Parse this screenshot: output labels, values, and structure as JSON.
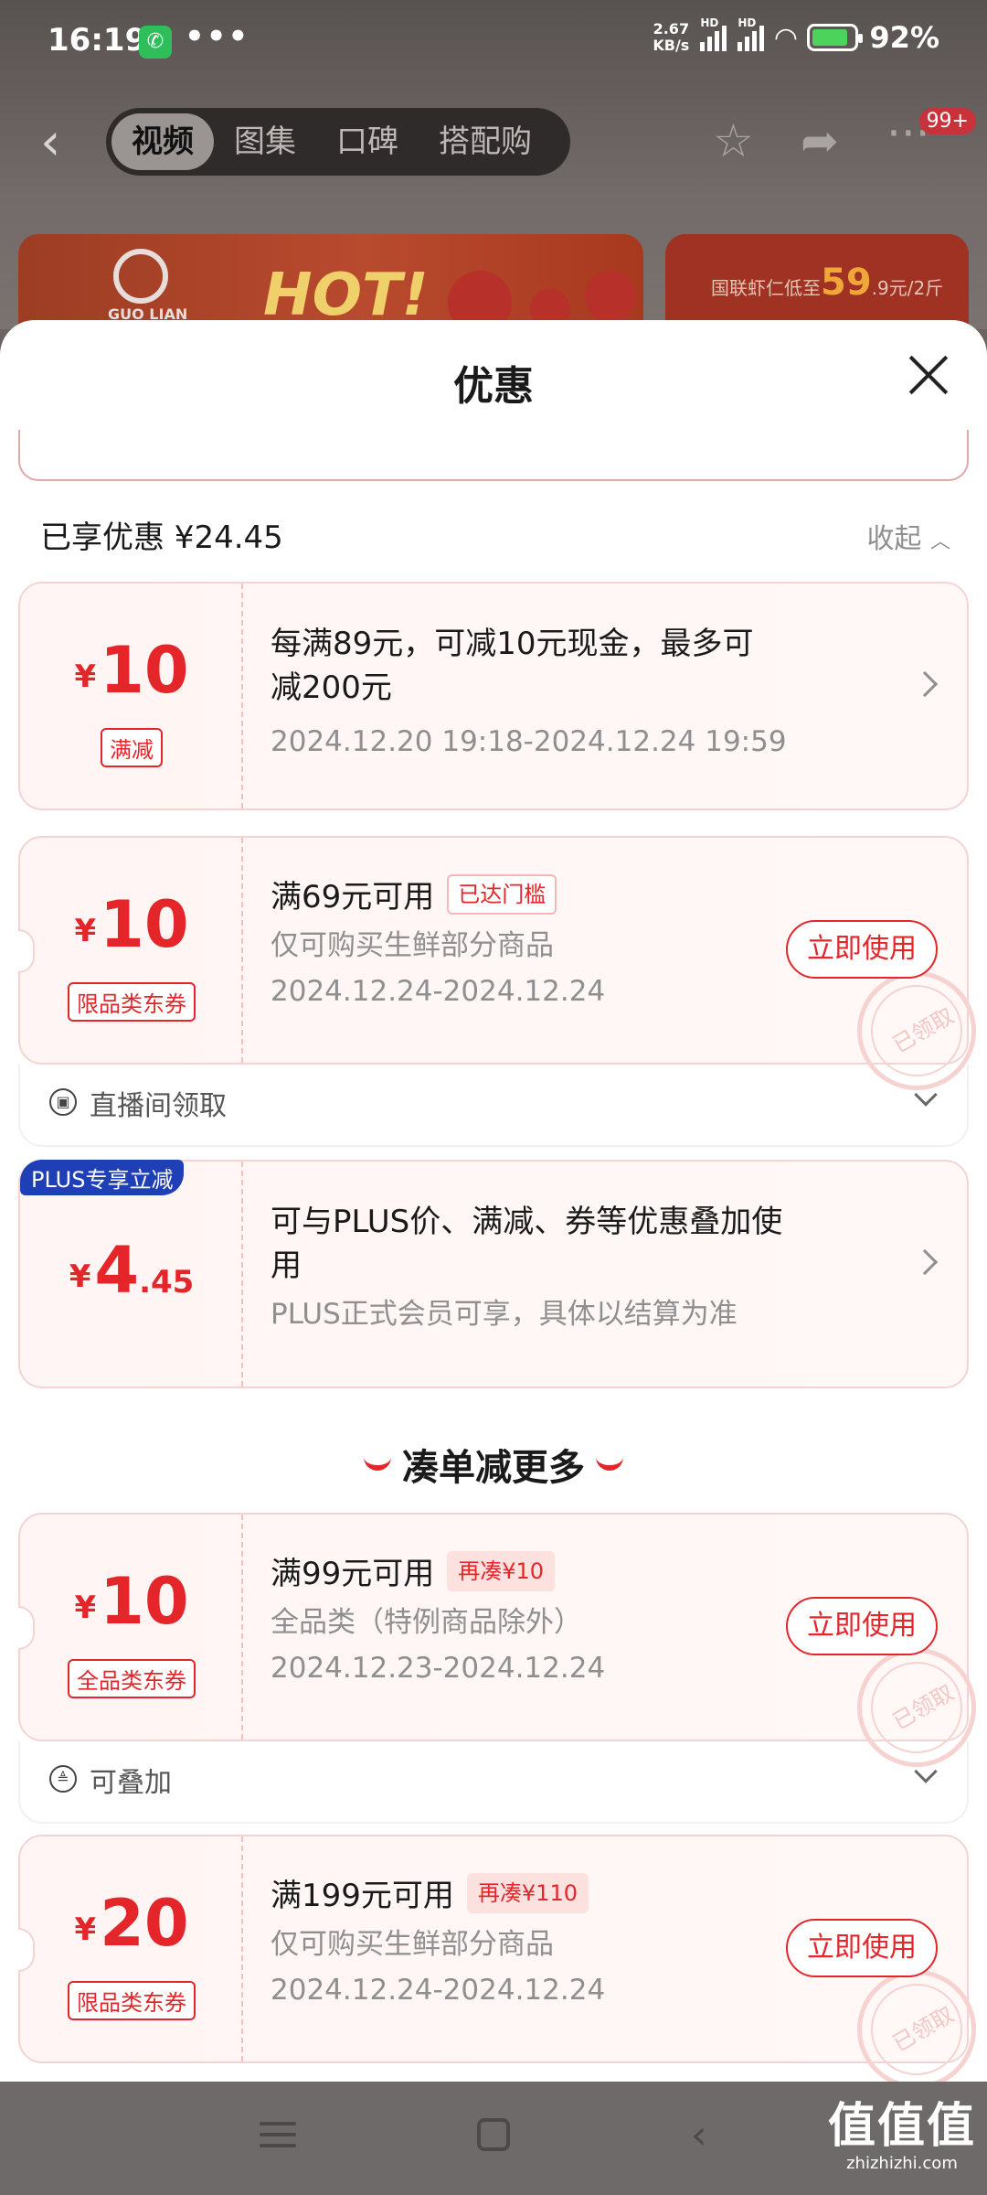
{
  "status_bar": {
    "time": "16:19",
    "dots": "•••",
    "net_speed_value": "2.67",
    "net_speed_unit": "KB/s",
    "hd1": "HD",
    "hd2": "HD",
    "battery": "92%"
  },
  "nav": {
    "tabs": [
      "视频",
      "图集",
      "口碑",
      "搭配购"
    ],
    "badge": "99+"
  },
  "banners": {
    "left_logo": "GUO LIAN",
    "left_hot": "HOT!",
    "right_prefix": "国联虾仁低至",
    "right_price": "59",
    "right_suffix": ".9元/2斤"
  },
  "sheet": {
    "title": "优惠",
    "enjoyed": "已享优惠 ¥24.45",
    "collapse": "收起"
  },
  "coupons": [
    {
      "currency": "¥",
      "amount": "10",
      "amount_dec": "",
      "tag": "满减",
      "line1": "每满89元，可减10元现金，最多可减200元",
      "line1_tag": "",
      "line2": "",
      "line3": "2024.12.20 19:18-2024.12.24 19:59",
      "action": ""
    },
    {
      "currency": "¥",
      "amount": "10",
      "amount_dec": "",
      "tag": "限品类东券",
      "line1": "满69元可用",
      "line1_tag": "已达门槛",
      "line2": "仅可购买生鲜部分商品",
      "line3": "2024.12.24-2024.12.24",
      "action": "立即使用",
      "stamp": "已领取",
      "footer": "直播间领取"
    },
    {
      "badge": "PLUS专享立减",
      "currency": "¥",
      "amount": "4",
      "amount_dec": ".45",
      "tag": "",
      "line1": "可与PLUS价、满减、券等优惠叠加使用",
      "line1_tag": "",
      "line2": "PLUS正式会员可享，具体以结算为准",
      "line3": "",
      "action": ""
    }
  ],
  "section_more": "凑单减更多",
  "more_coupons": [
    {
      "currency": "¥",
      "amount": "10",
      "tag": "全品类东券",
      "line1": "满99元可用",
      "line1_tag": "再凑¥10",
      "line2": "全品类（特例商品除外）",
      "line3": "2024.12.23-2024.12.24",
      "action": "立即使用",
      "stamp": "已领取",
      "footer": "可叠加"
    },
    {
      "currency": "¥",
      "amount": "20",
      "tag": "限品类东券",
      "line1": "满199元可用",
      "line1_tag": "再凑¥110",
      "line2": "仅可购买生鲜部分商品",
      "line3": "2024.12.24-2024.12.24",
      "action": "立即使用",
      "stamp": "已领取"
    }
  ],
  "watermark": {
    "big": "值值值",
    "small": "zhizhizhi.com"
  },
  "colors": {
    "accent": "#e4262a",
    "plus_blue": "#1f3fb6"
  },
  "icons": [
    "back-icon",
    "star-icon",
    "share-icon",
    "more-icon",
    "close-icon",
    "chevron-right-icon",
    "chevron-down-icon",
    "chevron-up-icon",
    "live-icon",
    "stack-icon",
    "menu-icon",
    "home-icon",
    "back-nav-icon"
  ]
}
